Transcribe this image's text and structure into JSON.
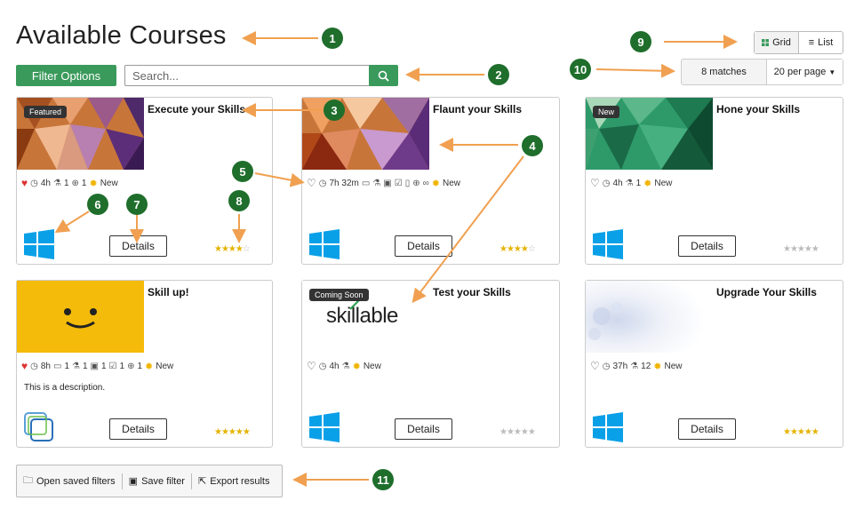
{
  "page_title": "Available Courses",
  "filter_button": "Filter Options",
  "search": {
    "placeholder": "Search..."
  },
  "view_toggle": {
    "grid": "Grid",
    "list": "List"
  },
  "results": {
    "matches": "8 matches",
    "per_page": "20 per page"
  },
  "details_label": "Details",
  "cards": [
    {
      "title": "Execute your Skills",
      "badge": "Featured",
      "favorite": true,
      "meta": [
        "4h",
        "1",
        "1",
        "New"
      ],
      "rating": 4,
      "os_icon": "windows-icon"
    },
    {
      "title": "Flaunt your Skills",
      "badge": "",
      "favorite": false,
      "meta": [
        "7h 32m",
        "New"
      ],
      "rating": 4,
      "os_icon": "windows-icon"
    },
    {
      "title": "Hone your Skills",
      "badge": "New",
      "favorite": false,
      "meta": [
        "4h",
        "1",
        "New"
      ],
      "rating": 0,
      "os_icon": "windows-icon"
    },
    {
      "title": "Skill up!",
      "badge": "",
      "favorite": true,
      "meta": [
        "8h",
        "1",
        "1",
        "1",
        "1",
        "1",
        "New"
      ],
      "rating": 5,
      "description": "This is a description.",
      "os_icon": "stack-icon"
    },
    {
      "title": "Test your Skills",
      "badge": "Coming Soon",
      "favorite": false,
      "meta": [
        "4h",
        "New"
      ],
      "rating": 0,
      "logo_text": "skillable",
      "os_icon": "windows-icon"
    },
    {
      "title": "Upgrade Your Skills",
      "badge": "",
      "favorite": false,
      "meta": [
        "37h",
        "12",
        "New"
      ],
      "rating": 5,
      "os_icon": "windows-icon"
    }
  ],
  "bottom_bar": {
    "open": "Open saved filters",
    "save": "Save filter",
    "export": "Export results"
  },
  "callouts": [
    "1",
    "2",
    "3",
    "4",
    "5",
    "6",
    "7",
    "8",
    "9",
    "10",
    "11"
  ],
  "colors": {
    "accent_green": "#3a9a5b",
    "callout_green": "#1f6e2c",
    "arrow_orange": "#f0a050",
    "star_gold": "#e5b300"
  }
}
